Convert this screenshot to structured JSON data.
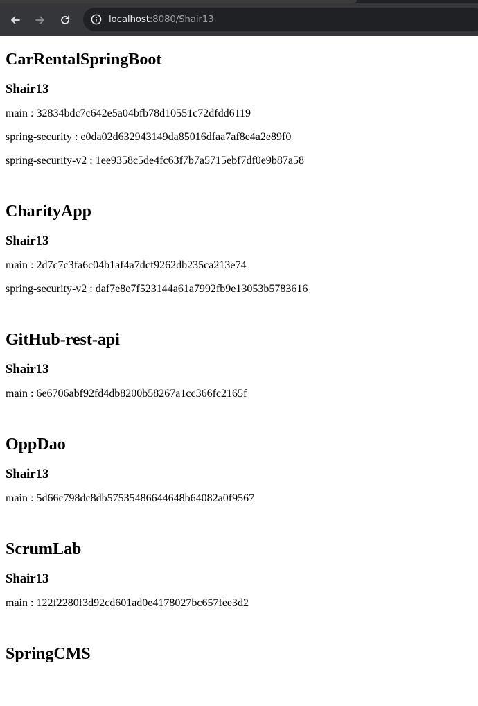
{
  "browser": {
    "url_host": "localhost",
    "url_rest": ":8080/Shair13",
    "icons": {
      "back": "arrow-left-icon",
      "forward": "arrow-right-icon",
      "reload": "reload-icon",
      "info": "info-icon"
    }
  },
  "repos": [
    {
      "name": "CarRentalSpringBoot",
      "owner": "Shair13",
      "branches": [
        "main : 32834bdc7c642e5a04bfb78d10551c72dfdd6119",
        "spring-security : e0da02d632943149da85016dfaa7af8e4a2e89f0",
        "spring-security-v2 : 1ee9358c5de4fc63f7b7a5715ebf7df0e9b87a58"
      ]
    },
    {
      "name": "CharityApp",
      "owner": "Shair13",
      "branches": [
        "main : 2d7c7c3fa6c04b1af4a7dcf9262db235ca213e74",
        "spring-security-v2 : daf7e8e7f523144a61a7992fb9e13053b5783616"
      ]
    },
    {
      "name": "GitHub-rest-api",
      "owner": "Shair13",
      "branches": [
        "main : 6e6706abf92fd4db8200b58267a1cc366fc2165f"
      ]
    },
    {
      "name": "OppDao",
      "owner": "Shair13",
      "branches": [
        "main : 5d66c798dc8db57535486644648b64082a0f9567"
      ]
    },
    {
      "name": "ScrumLab",
      "owner": "Shair13",
      "branches": [
        "main : 122f2280f3d92cd601ad0e4178027bc657fee3d2"
      ]
    },
    {
      "name": "SpringCMS"
    }
  ]
}
